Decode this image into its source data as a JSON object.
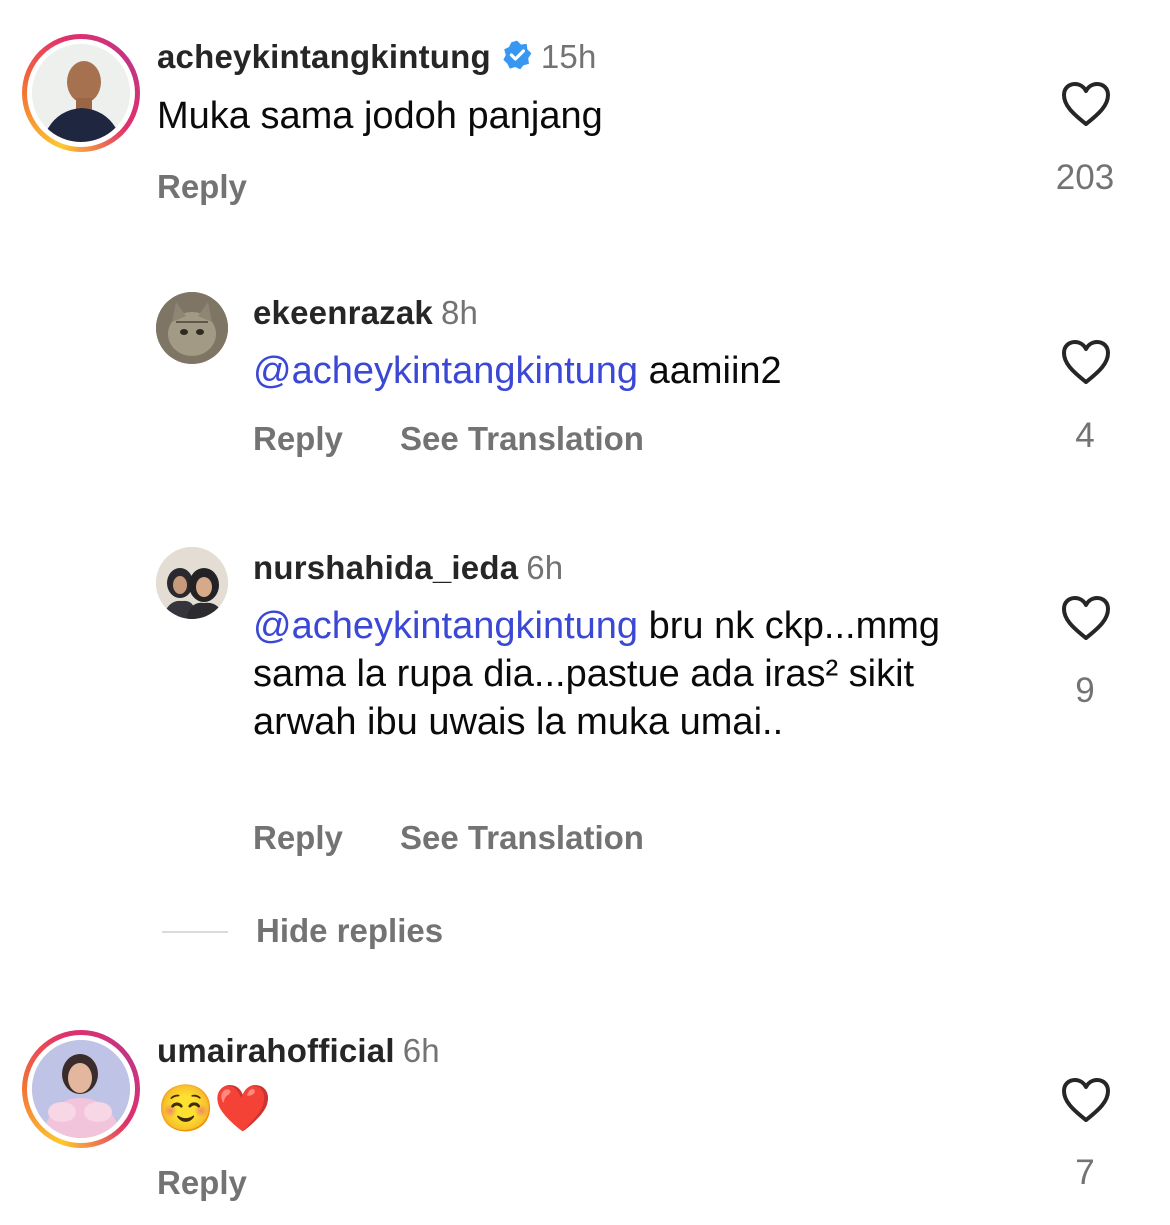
{
  "comments": [
    {
      "username": "acheykintangkintung",
      "verified": true,
      "time": "15h",
      "text": "Muka sama jodoh panjang",
      "reply_label": "Reply",
      "likes": "203",
      "avatar_icon": "profile-photo-man"
    },
    {
      "username": "umairahofficial",
      "time": "6h",
      "text": "☺️❤️",
      "reply_label": "Reply",
      "likes": "7",
      "avatar_icon": "profile-photo-woman"
    }
  ],
  "replies": [
    {
      "username": "ekeenrazak",
      "time": "8h",
      "mention": "@acheykintangkintung",
      "text": " aamiin2",
      "reply_label": "Reply",
      "translate_label": "See Translation",
      "likes": "4",
      "avatar_icon": "profile-photo-cat"
    },
    {
      "username": "nurshahida_ieda",
      "time": "6h",
      "mention": "@acheykintangkintung",
      "text": " bru nk ckp...mmg sama la rupa dia...pastue ada iras² sikit arwah ibu uwais la muka umai..",
      "reply_label": "Reply",
      "translate_label": "See Translation",
      "likes": "9",
      "avatar_icon": "profile-photo-women"
    }
  ],
  "hide_replies_label": "Hide replies",
  "colors": {
    "mention": "#3b48d6",
    "muted": "#737373",
    "verified": "#3897f0"
  }
}
